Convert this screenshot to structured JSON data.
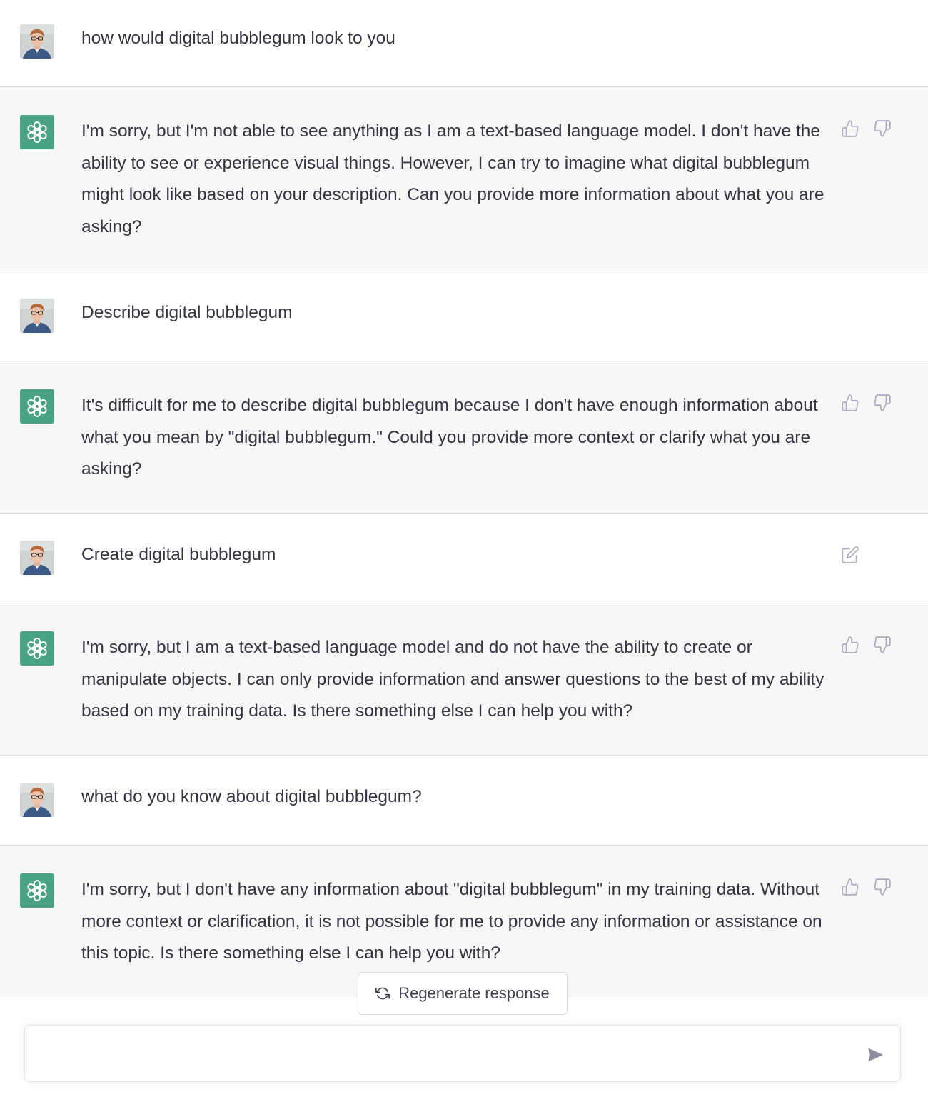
{
  "conversation": {
    "messages": [
      {
        "role": "user",
        "text": "how would digital bubblegum look to you"
      },
      {
        "role": "assistant",
        "text": "I'm sorry, but I'm not able to see anything as I am a text-based language model. I don't have the ability to see or experience visual things. However, I can try to imagine what digital bubblegum might look like based on your description. Can you provide more information about what you are asking?"
      },
      {
        "role": "user",
        "text": "Describe digital bubblegum"
      },
      {
        "role": "assistant",
        "text": "It's difficult for me to describe digital bubblegum because I don't have enough information about what you mean by \"digital bubblegum.\" Could you provide more context or clarify what you are asking?"
      },
      {
        "role": "user",
        "text": "Create digital bubblegum"
      },
      {
        "role": "assistant",
        "text": "I'm sorry, but I am a text-based language model and do not have the ability to create or manipulate objects. I can only provide information and answer questions to the best of my ability based on my training data. Is there something else I can help you with?"
      },
      {
        "role": "user",
        "text": "what do you know about digital bubblegum?"
      },
      {
        "role": "assistant",
        "text": "I'm sorry, but I don't have any information about \"digital bubblegum\" in my training data. Without more context or clarification, it is not possible for me to provide any information or assistance on this topic. Is there something else I can help you with?"
      }
    ]
  },
  "actions": {
    "regenerate_label": "Regenerate response"
  },
  "composer": {
    "value": "",
    "placeholder": ""
  },
  "icons": {
    "thumbs_up": "thumbs-up-icon",
    "thumbs_down": "thumbs-down-icon",
    "edit": "edit-icon",
    "regenerate": "refresh-icon",
    "send": "send-icon",
    "assistant_logo": "openai-logo-icon"
  },
  "colors": {
    "assistant_bg": "#f7f7f8",
    "user_bg": "#ffffff",
    "assistant_avatar": "#4aa383",
    "text": "#343541",
    "icon": "#acacbe"
  }
}
